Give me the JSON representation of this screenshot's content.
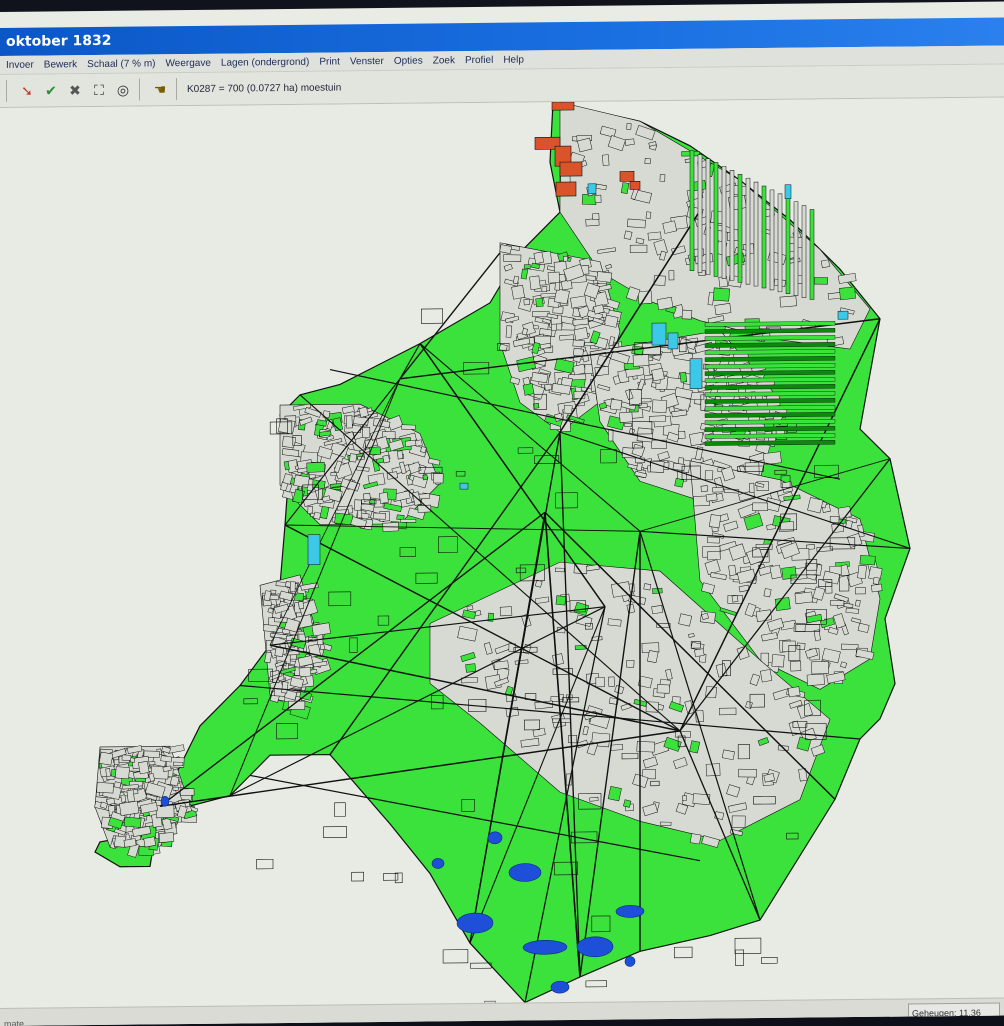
{
  "window": {
    "title": "oktober 1832"
  },
  "menu": {
    "items": [
      {
        "label": "Invoer",
        "color": "#1d2b57"
      },
      {
        "label": "Bewerk",
        "color": "#1d2b57"
      },
      {
        "label": "Schaal (7 % m)",
        "color": "#1d2b57"
      },
      {
        "label": "Weergave",
        "color": "#1d2b57"
      },
      {
        "label": "Lagen (ondergrond)",
        "color": "#1d2b57"
      },
      {
        "label": "Print",
        "color": "#1d2b57"
      },
      {
        "label": "Venster",
        "color": "#1d2b57"
      },
      {
        "label": "Opties",
        "color": "#1d2b57"
      },
      {
        "label": "Zoek",
        "color": "#1d2b57"
      },
      {
        "label": "Profiel",
        "color": "#1d2b57"
      },
      {
        "label": "Help",
        "color": "#1d2b57"
      }
    ]
  },
  "toolbar": {
    "buttons": [
      {
        "icon": "pointer-arrow-icon",
        "glyph": "➘",
        "color": "#c0392b"
      },
      {
        "icon": "check-icon",
        "glyph": "✔",
        "color": "#2e8b3a"
      },
      {
        "icon": "delete-x-icon",
        "glyph": "✖",
        "color": "#555"
      },
      {
        "icon": "select-area-icon",
        "glyph": "⛶",
        "color": "#333"
      },
      {
        "icon": "target-icon",
        "glyph": "◎",
        "color": "#333"
      },
      {
        "icon": "hand-icon",
        "glyph": "☚",
        "color": "#7a5c00"
      }
    ],
    "status": "K0287 = 700 (0.0727 ha) moestuin"
  },
  "map": {
    "colors": {
      "grass": "#3be23b",
      "parcel": "#d7dad2",
      "lines": "#111111",
      "water": "#1d4fd8",
      "brick": "#d9542a",
      "cyan": "#3cc9e8",
      "dark_green": "#0a8a0a"
    }
  },
  "statusbar": {
    "left": "mate",
    "right": "Geheugen: 11.36"
  }
}
